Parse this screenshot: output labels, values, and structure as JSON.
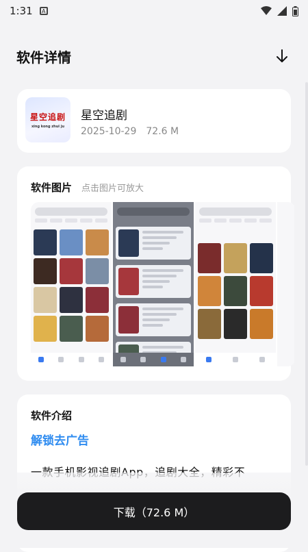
{
  "status": {
    "time": "1:31"
  },
  "header": {
    "title": "软件详情"
  },
  "app": {
    "logo_text": "星空追剧",
    "logo_pinyin": "xing kong zhui ju",
    "name": "星空追剧",
    "date": "2025-10-29",
    "size": "72.6 M"
  },
  "screenshots": {
    "title": "软件图片",
    "hint": "点击图片可放大",
    "poster_colors": [
      "#2b3a55",
      "#6a8fc4",
      "#c98b4a",
      "#3d2a22",
      "#a6373c",
      "#7b8ea6",
      "#d9c7a3",
      "#2e3140",
      "#8c2f39",
      "#e0b24c",
      "#4a5d4f",
      "#b56a3a"
    ],
    "poster_colors_b": [
      "#7a2c2c",
      "#c4a25c",
      "#24324a",
      "#d0853a",
      "#3c4a3c",
      "#b83a2e",
      "#8a6a3a",
      "#2a2a2a",
      "#c97a2a"
    ]
  },
  "intro": {
    "title": "软件介绍",
    "subtitle": "解锁去广告",
    "text": "一款手机影视追剧App，追剧大全，精彩不"
  },
  "download": {
    "label": "下载（72.6 M）"
  }
}
